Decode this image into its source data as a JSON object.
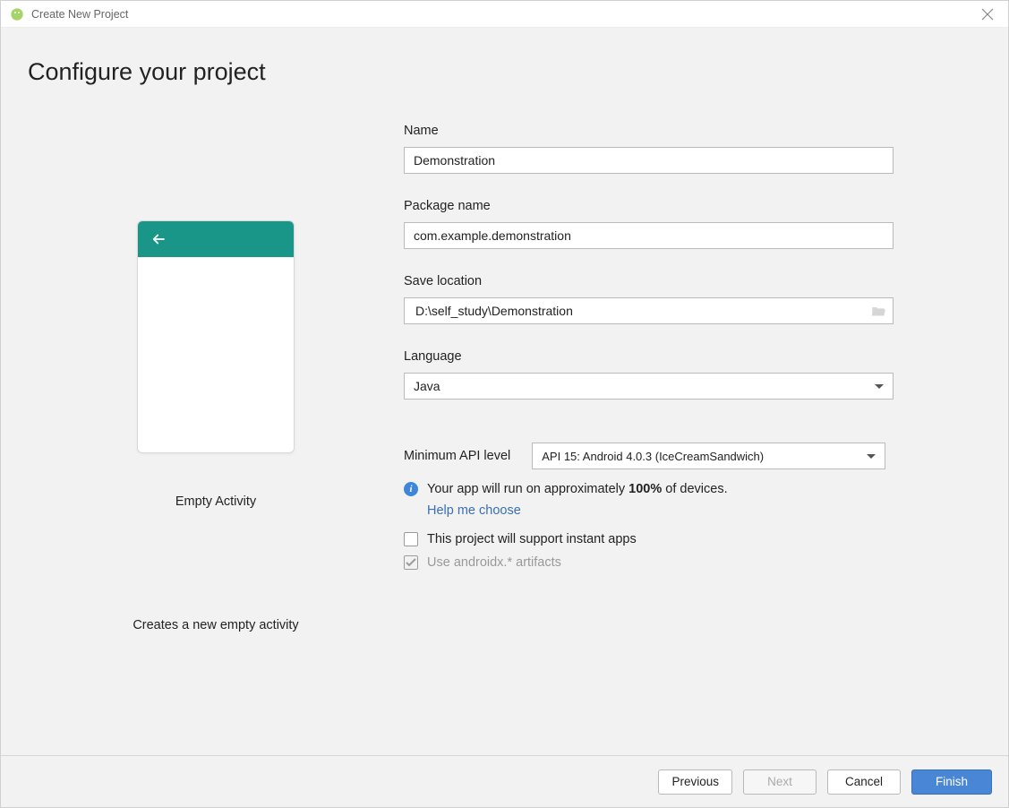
{
  "window": {
    "title": "Create New Project"
  },
  "page": {
    "title": "Configure your project"
  },
  "preview": {
    "label": "Empty Activity",
    "description": "Creates a new empty activity"
  },
  "form": {
    "name": {
      "label": "Name",
      "value": "Demonstration"
    },
    "package_name": {
      "label": "Package name",
      "value": "com.example.demonstration"
    },
    "save_location": {
      "label": "Save location",
      "value": "D:\\self_study\\Demonstration"
    },
    "language": {
      "label": "Language",
      "value": "Java"
    },
    "min_api": {
      "label": "Minimum API level",
      "value": "API 15: Android 4.0.3 (IceCreamSandwich)"
    },
    "device_info_prefix": "Your app will run on approximately ",
    "device_info_pct": "100%",
    "device_info_suffix": " of devices.",
    "help_link": "Help me choose",
    "instant_apps_label": "This project will support instant apps",
    "androidx_label": "Use androidx.* artifacts"
  },
  "footer": {
    "previous": "Previous",
    "next": "Next",
    "cancel": "Cancel",
    "finish": "Finish"
  }
}
